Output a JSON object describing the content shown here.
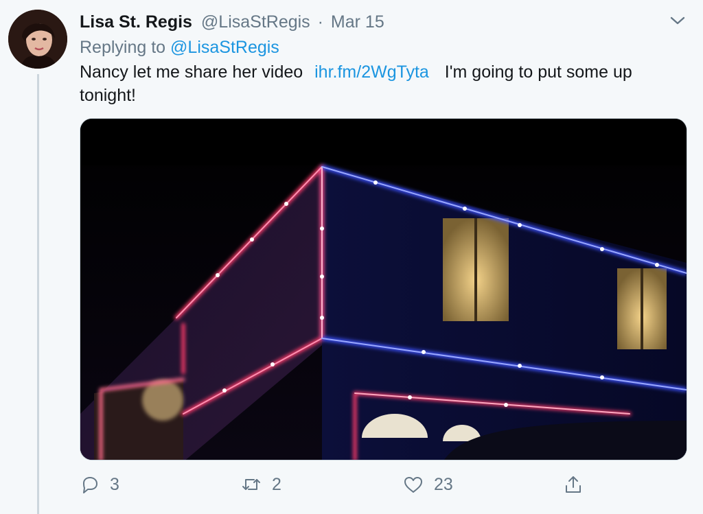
{
  "tweet": {
    "author_name": "Lisa St. Regis",
    "handle": "@LisaStRegis",
    "separator": "·",
    "date": "Mar 15",
    "replying_prefix": "Replying to",
    "replying_handle": "@LisaStRegis",
    "text_before": "Nancy let me share her video",
    "link": "ihr.fm/2WgTyta",
    "text_after": "I'm going to put some up tonight!"
  },
  "actions": {
    "reply_count": "3",
    "retweet_count": "2",
    "like_count": "23"
  },
  "icons": {
    "menu": "chevron-down-icon",
    "reply": "reply-icon",
    "retweet": "retweet-icon",
    "like": "heart-icon",
    "share": "share-icon"
  },
  "colors": {
    "link": "#1b95e0",
    "meta": "#657786",
    "text": "#14171a"
  }
}
